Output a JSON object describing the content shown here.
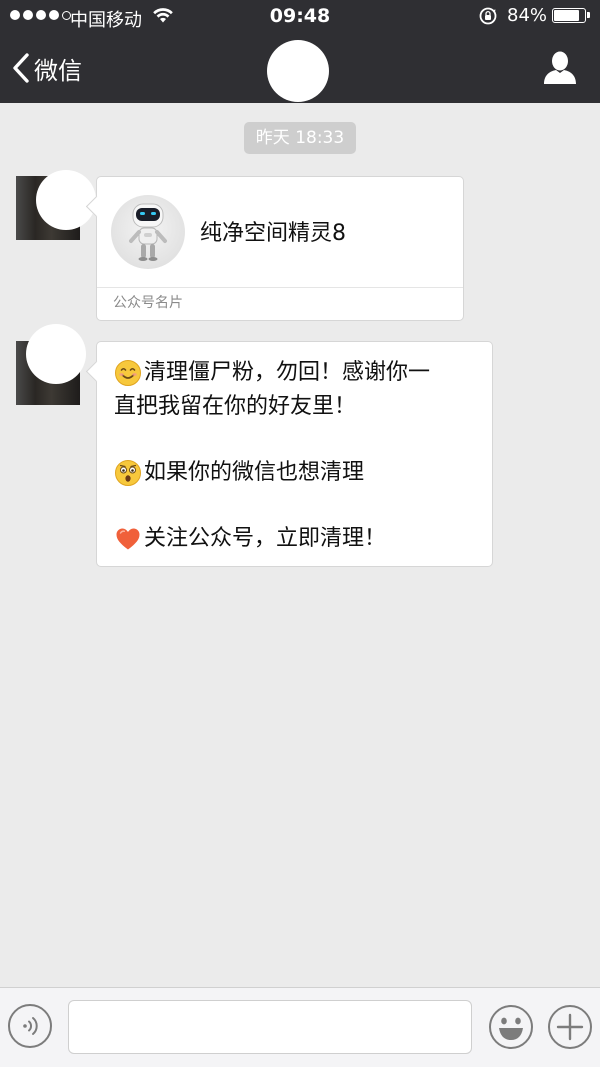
{
  "status_bar": {
    "carrier": "中国移动",
    "time": "09:48",
    "battery_percent": "84%",
    "battery_level": 0.84,
    "signal_bars_filled": 4,
    "signal_bars_total": 5
  },
  "nav": {
    "back_label": "微信",
    "back_icon": "chevron-left-icon",
    "profile_icon": "person-icon"
  },
  "chat": {
    "timestamp": "昨天 18:33",
    "messages": [
      {
        "type": "card",
        "card_name": "纯净空间精灵8",
        "card_footer": "公众号名片"
      },
      {
        "type": "text",
        "lines": [
          {
            "emoji": "smiling-face-emoji",
            "text": "清理僵尸粉，勿回！感谢你一"
          },
          {
            "emoji": "",
            "text": "直把我留在你的好友里！"
          },
          {
            "emoji": "",
            "text": ""
          },
          {
            "emoji": "astonished-face-emoji",
            "text": "如果你的微信也想清理"
          },
          {
            "emoji": "",
            "text": ""
          },
          {
            "emoji": "heart-emoji",
            "text": "关注公众号，立即清理！"
          }
        ]
      }
    ]
  },
  "input_bar": {
    "voice_icon": "voice-icon",
    "emoji_icon": "emoji-face-icon",
    "plus_icon": "plus-icon",
    "input_value": ""
  },
  "colors": {
    "nav_background": "#2f2f33",
    "chat_background": "#ebebeb",
    "timestamp_background": "#cecece",
    "bubble_background": "#ffffff"
  }
}
